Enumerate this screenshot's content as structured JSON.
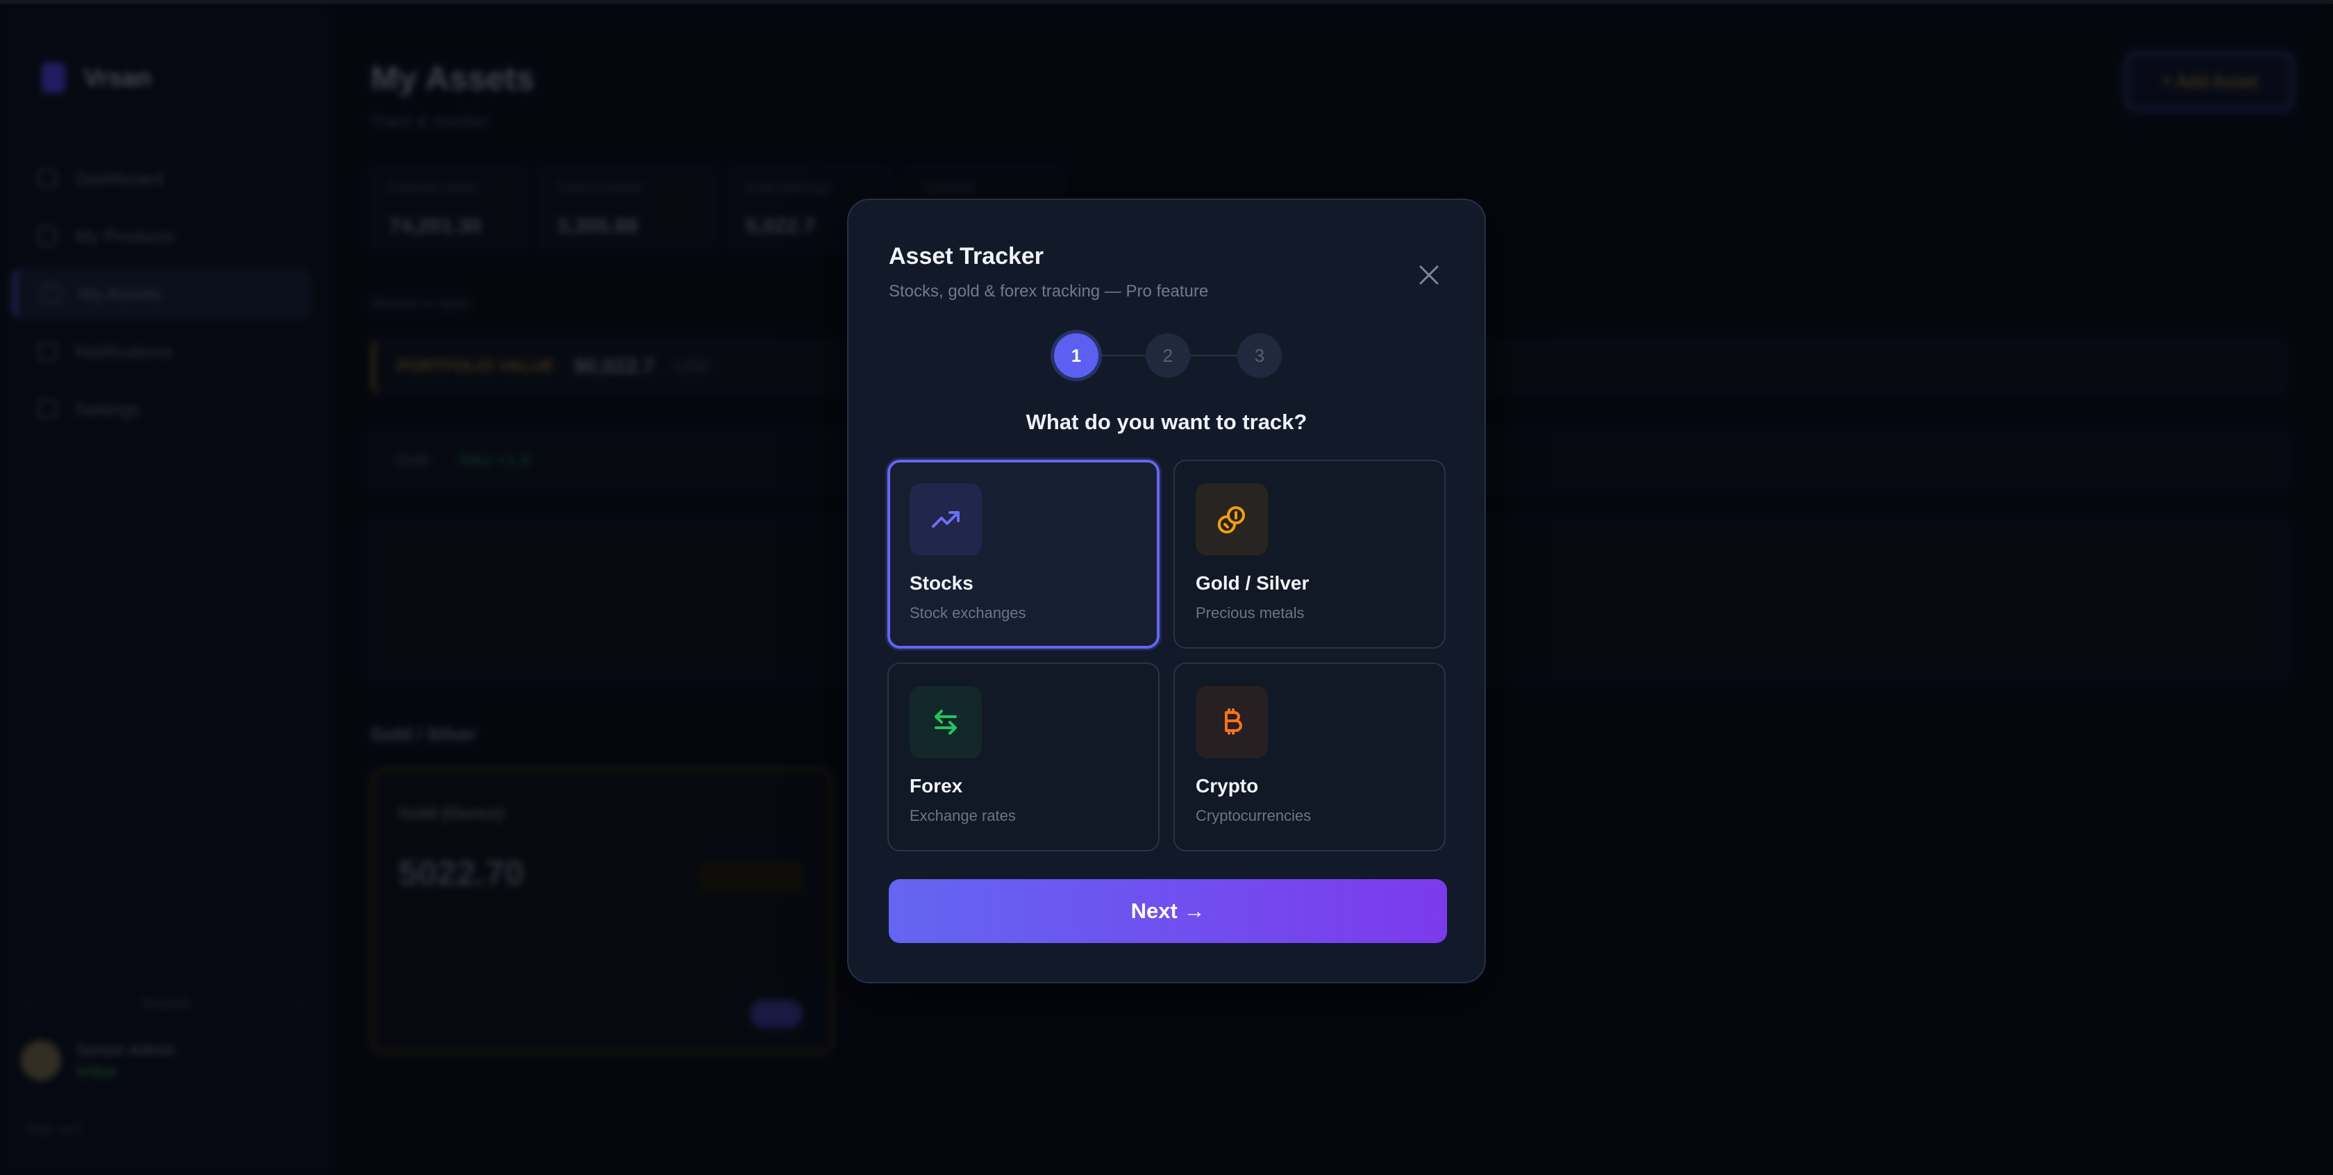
{
  "app": {
    "brand": "Vrsan",
    "nav": [
      "Dashboard",
      "My Products",
      "My Assets",
      "Notifications",
      "Settings"
    ],
    "sidebar_search": "Search",
    "user": {
      "name": "Senior Admin",
      "badge": "Online"
    },
    "sidebar_footer": "Sign out"
  },
  "page": {
    "title": "My Assets",
    "subtitle": "Track & monitor",
    "add_button": "+ Add Asset",
    "stats": [
      {
        "label": "Portfolio value",
        "value": "74,201.30"
      },
      {
        "label": "Total invested",
        "value": "3,305.88"
      },
      {
        "label": "Gold holdings",
        "value": "5,022.7"
      },
      {
        "label": "Updated",
        "value": ""
      }
    ],
    "status_line": "Market is open",
    "portfolio": {
      "label": "PORTFOLIO VALUE",
      "value": "90,022.7",
      "unit": "USD"
    },
    "ticker": {
      "label": "Gold",
      "change": "XAU +1.4"
    },
    "section_title": "Gold / Silver",
    "asset_card": {
      "name": "Gold (Ounce)",
      "price": "5022.70"
    }
  },
  "modal": {
    "title": "Asset Tracker",
    "subtitle": "Stocks, gold & forex tracking — Pro feature",
    "steps": [
      "1",
      "2",
      "3"
    ],
    "current_step": 1,
    "question": "What do you want to track?",
    "options": [
      {
        "label": "Stocks",
        "desc": "Stock exchanges",
        "icon": "trending-up-icon",
        "selected": true,
        "color": "#6c6ff5",
        "tint": "#21274a"
      },
      {
        "label": "Gold / Silver",
        "desc": "Precious metals",
        "icon": "coins-icon",
        "selected": false,
        "color": "#f59e0b",
        "tint": "#272421"
      },
      {
        "label": "Forex",
        "desc": "Exchange rates",
        "icon": "arrows-exchange-icon",
        "selected": false,
        "color": "#22c55e",
        "tint": "#13282a"
      },
      {
        "label": "Crypto",
        "desc": "Cryptocurrencies",
        "icon": "bitcoin-icon",
        "selected": false,
        "color": "#f97316",
        "tint": "#281f23"
      }
    ],
    "next_button": "Next →"
  }
}
